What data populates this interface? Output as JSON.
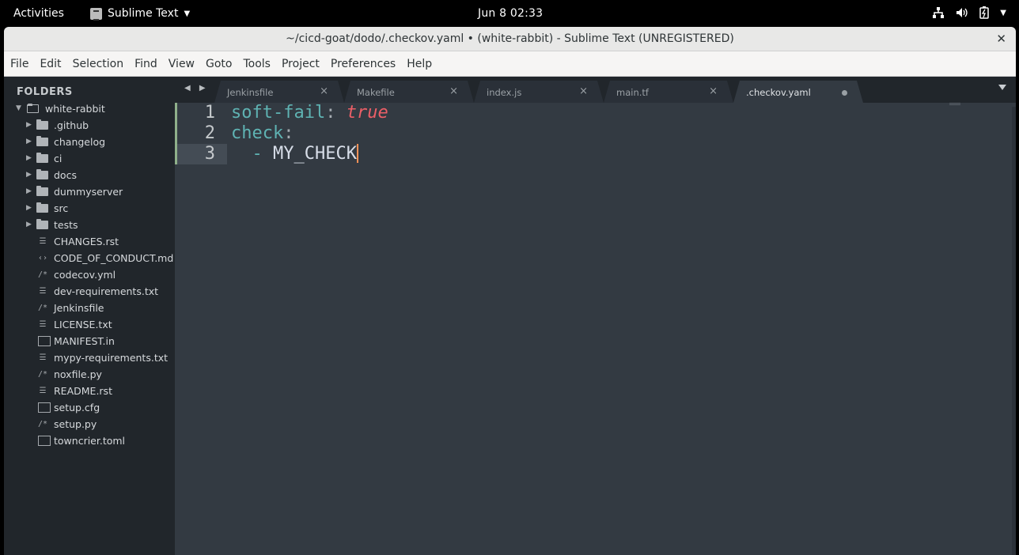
{
  "topbar": {
    "activities": "Activities",
    "app_name": "Sublime Text",
    "clock": "Jun 8  02:33"
  },
  "window": {
    "title": "~/cicd-goat/dodo/.checkov.yaml • (white-rabbit) - Sublime Text (UNREGISTERED)",
    "close_glyph": "✕"
  },
  "menu": {
    "items": [
      "File",
      "Edit",
      "Selection",
      "Find",
      "View",
      "Goto",
      "Tools",
      "Project",
      "Preferences",
      "Help"
    ]
  },
  "sidebar": {
    "heading": "FOLDERS",
    "root": "white-rabbit",
    "folders": [
      ".github",
      "changelog",
      "ci",
      "docs",
      "dummyserver",
      "src",
      "tests"
    ],
    "files": [
      {
        "name": "CHANGES.rst",
        "icon": "lines-icon"
      },
      {
        "name": "CODE_OF_CONDUCT.md",
        "icon": "code-icon"
      },
      {
        "name": "codecov.yml",
        "icon": "comment-icon"
      },
      {
        "name": "dev-requirements.txt",
        "icon": "lines-icon"
      },
      {
        "name": "Jenkinsfile",
        "icon": "comment-icon"
      },
      {
        "name": "LICENSE.txt",
        "icon": "lines-icon"
      },
      {
        "name": "MANIFEST.in",
        "icon": "doc-icon"
      },
      {
        "name": "mypy-requirements.txt",
        "icon": "lines-icon"
      },
      {
        "name": "noxfile.py",
        "icon": "comment-icon"
      },
      {
        "name": "README.rst",
        "icon": "lines-icon"
      },
      {
        "name": "setup.cfg",
        "icon": "doc-icon"
      },
      {
        "name": "setup.py",
        "icon": "comment-icon"
      },
      {
        "name": "towncrier.toml",
        "icon": "doc-icon"
      }
    ]
  },
  "tabs": [
    {
      "label": "Jenkinsfile",
      "active": false,
      "dirty": false
    },
    {
      "label": "Makefile",
      "active": false,
      "dirty": false
    },
    {
      "label": "index.js",
      "active": false,
      "dirty": false
    },
    {
      "label": "main.tf",
      "active": false,
      "dirty": false
    },
    {
      "label": ".checkov.yaml",
      "active": true,
      "dirty": true
    }
  ],
  "editor": {
    "lines": [
      {
        "number": "1",
        "key": "soft-fail",
        "sep": ":",
        "value": "true"
      },
      {
        "number": "2",
        "key": "check",
        "sep": ":",
        "value": ""
      },
      {
        "number": "3",
        "dash": "  - ",
        "item": "MY_CHECK"
      }
    ],
    "current_line": 3
  },
  "colors": {
    "editor_bg": "#333a42",
    "sidebar_bg": "#21262b",
    "key": "#5fb3b3",
    "bool": "#ec5f67",
    "cursor": "#f99157"
  }
}
